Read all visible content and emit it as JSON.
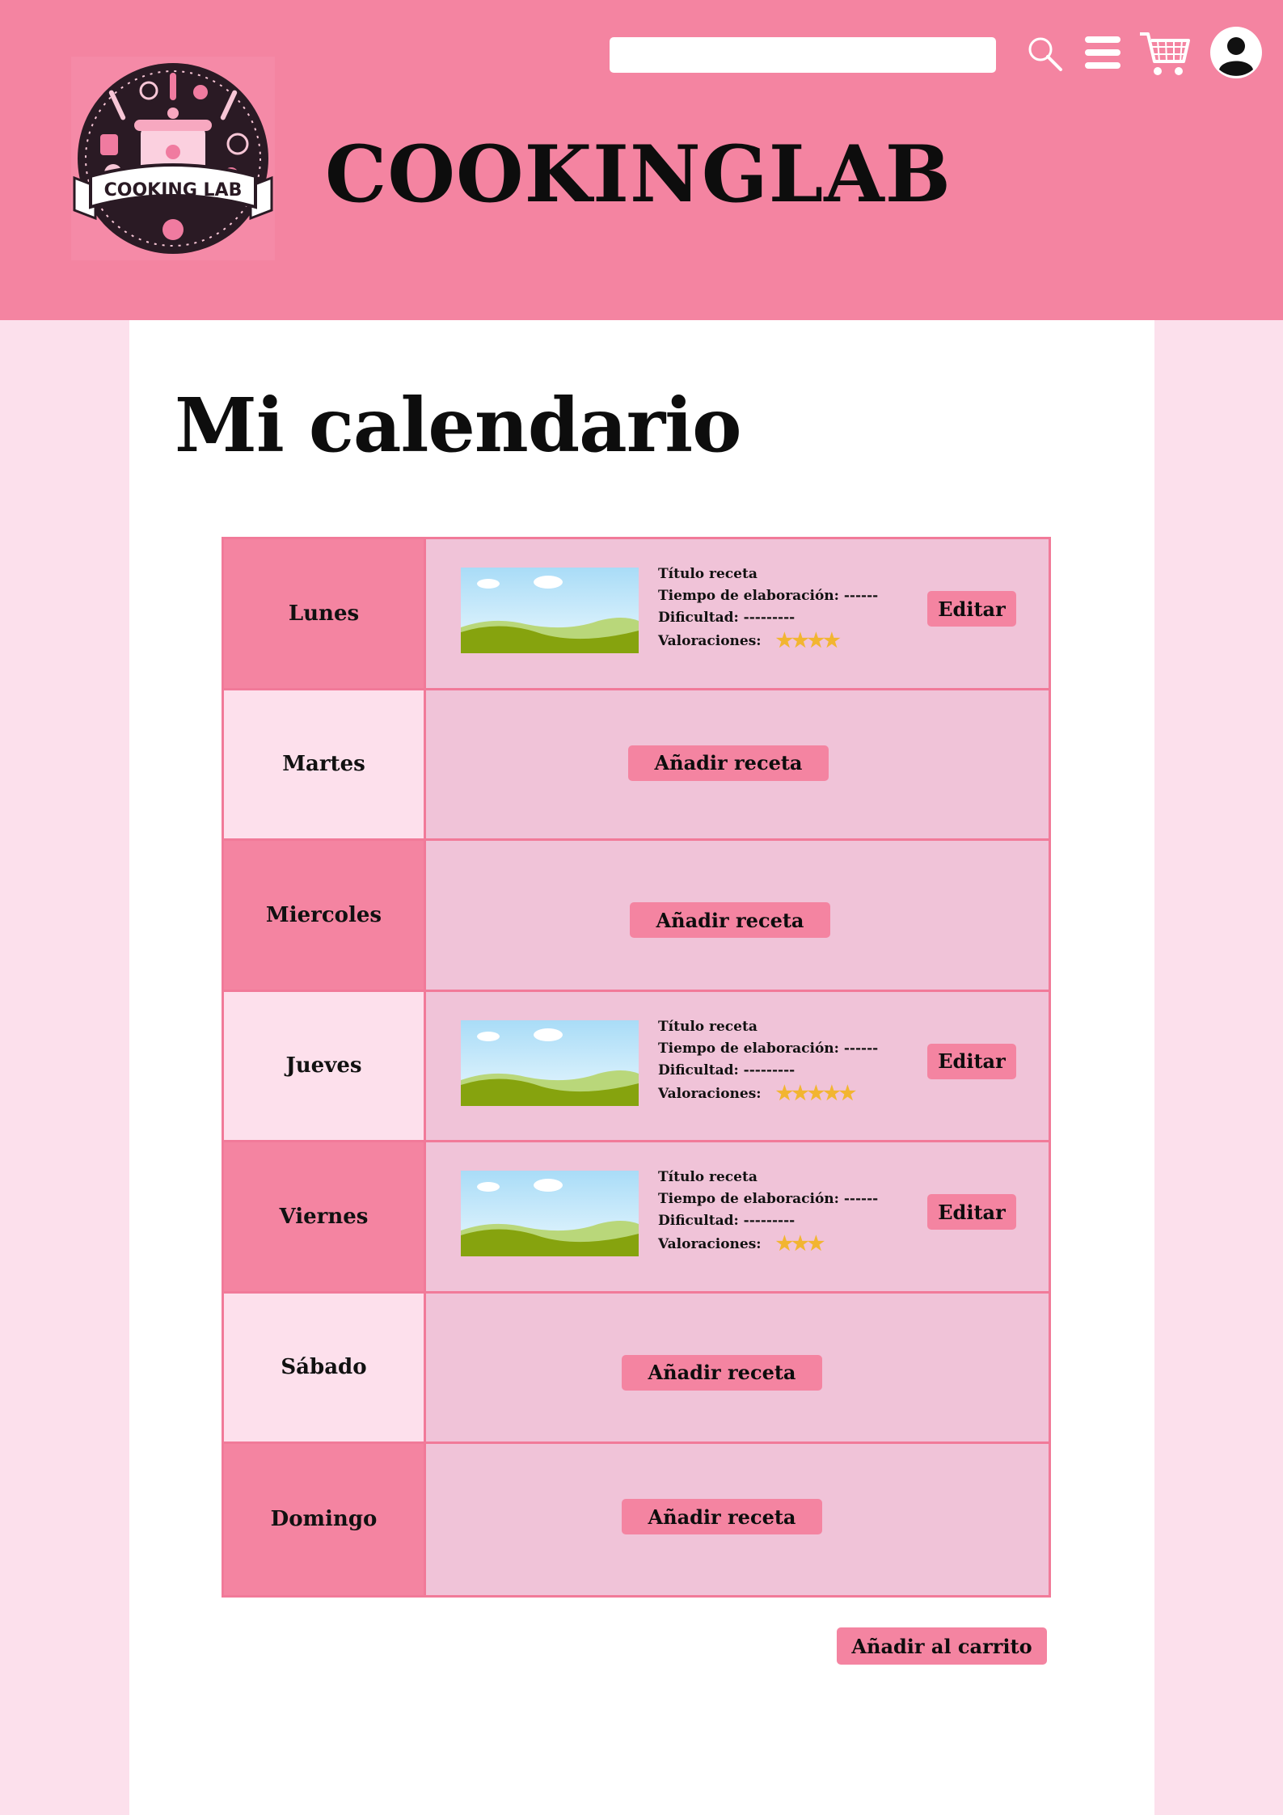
{
  "header": {
    "brand": "COOKINGLAB",
    "logo_text": "COOKING LAB",
    "search_placeholder": "",
    "icons": [
      "search-icon",
      "menu-icon",
      "cart-icon",
      "user-icon"
    ]
  },
  "main": {
    "title": "Mi calendario",
    "days": [
      {
        "name": "Lunes",
        "has_recipe": true,
        "title": "Título receta",
        "time": "Tiempo de elaboración: ------",
        "difficulty": "Dificultad: ---------",
        "ratings_label": "Valoraciones:",
        "stars": "★★★★",
        "rating": 4,
        "action": "Editar"
      },
      {
        "name": "Martes",
        "has_recipe": false,
        "action": "Añadir receta"
      },
      {
        "name": "Miercoles",
        "has_recipe": false,
        "action": "Añadir receta"
      },
      {
        "name": "Jueves",
        "has_recipe": true,
        "title": "Título receta",
        "time": "Tiempo de elaboración: ------",
        "difficulty": "Dificultad: ---------",
        "ratings_label": "Valoraciones:",
        "stars": "★★★★★",
        "rating": 5,
        "action": "Editar"
      },
      {
        "name": "Viernes",
        "has_recipe": true,
        "title": "Título receta",
        "time": "Tiempo de elaboración: ------",
        "difficulty": "Dificultad: ---------",
        "ratings_label": "Valoraciones:",
        "stars": "★★★",
        "rating": 3,
        "action": "Editar"
      },
      {
        "name": "Sábado",
        "has_recipe": false,
        "action": "Añadir receta"
      },
      {
        "name": "Domingo",
        "has_recipe": false,
        "action": "Añadir receta"
      }
    ],
    "cart_button": "Añadir al carrito"
  },
  "colors": {
    "header": "#f484a1",
    "page_bg": "#fce0ec",
    "cell": "#f0c3d8",
    "border": "#f17a99",
    "star": "#f2b531"
  }
}
